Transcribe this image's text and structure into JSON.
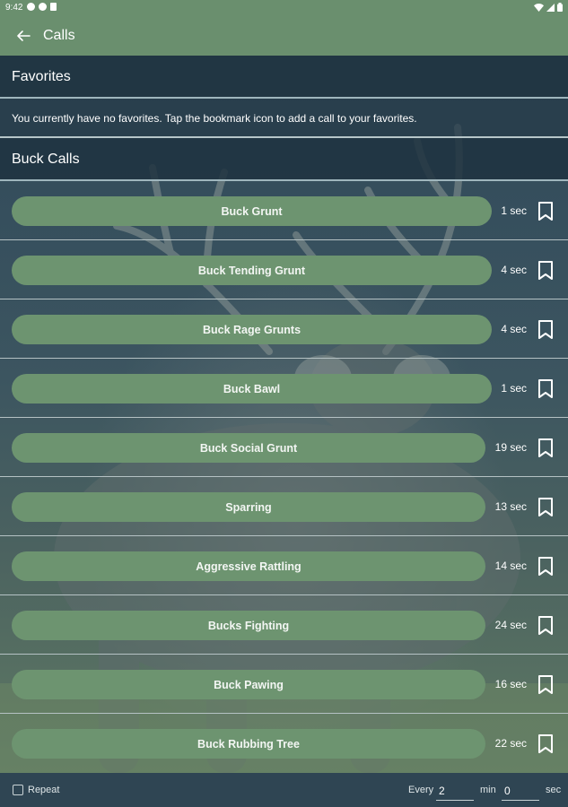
{
  "status_bar": {
    "time": "9:42"
  },
  "app_bar": {
    "title": "Calls"
  },
  "favorites": {
    "title": "Favorites",
    "empty_message": "You currently have no favorites. Tap the bookmark icon to add a call to your favorites."
  },
  "buck_calls": {
    "title": "Buck Calls",
    "items": [
      {
        "name": "Buck Grunt",
        "duration": "1 sec"
      },
      {
        "name": "Buck Tending Grunt",
        "duration": "4 sec"
      },
      {
        "name": "Buck Rage Grunts",
        "duration": "4 sec"
      },
      {
        "name": "Buck Bawl",
        "duration": "1 sec"
      },
      {
        "name": "Buck Social Grunt",
        "duration": "19 sec"
      },
      {
        "name": "Sparring",
        "duration": "13 sec"
      },
      {
        "name": "Aggressive Rattling",
        "duration": "14 sec"
      },
      {
        "name": "Bucks Fighting",
        "duration": "24 sec"
      },
      {
        "name": "Buck Pawing",
        "duration": "16 sec"
      },
      {
        "name": "Buck Rubbing Tree",
        "duration": "22 sec"
      }
    ]
  },
  "bottom_bar": {
    "repeat_label": "Repeat",
    "every_label": "Every",
    "min_value": "2",
    "min_label": "min",
    "sec_value": "0",
    "sec_label": "sec"
  },
  "colors": {
    "accent_green": "#6a8f6e",
    "button_green": "#6d9470",
    "header_dark": "#1f3240",
    "bottom_bar": "#2f4553"
  },
  "icons": {
    "back": "arrow-left-icon",
    "bookmark": "bookmark-outline-icon",
    "wifi": "wifi-icon",
    "signal": "signal-icon",
    "battery": "battery-icon"
  }
}
